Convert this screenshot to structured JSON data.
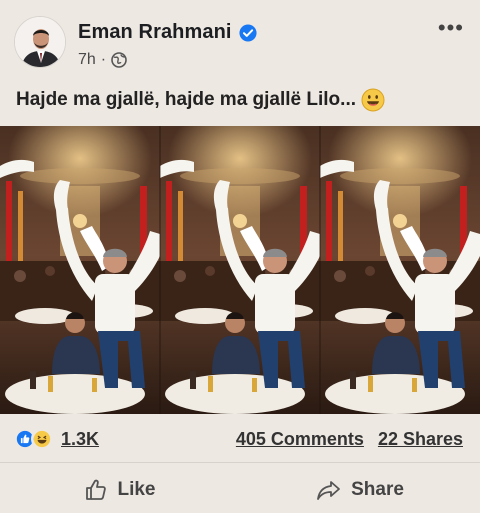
{
  "post": {
    "author": "Eman Rrahmani",
    "time": "7h",
    "meta_separator": "·",
    "caption": "Hajde ma gjallë, hajde ma gjallë Lilo...",
    "more_label": "•••"
  },
  "stats": {
    "reactions_count": "1.3K",
    "comments": "405 Comments",
    "shares": "22 Shares"
  },
  "actions": {
    "like_label": "Like",
    "share_label": "Share"
  },
  "colors": {
    "background": "#eee8e2",
    "verified_blue": "#1877f2",
    "like_blue": "#1877f2",
    "haha_yellow": "#f7c948"
  },
  "icons": [
    "verified-badge-icon",
    "globe-icon",
    "more-options-icon",
    "smiley-emoji-icon",
    "like-reaction-icon",
    "haha-reaction-icon",
    "thumbs-up-icon",
    "share-arrow-icon"
  ]
}
